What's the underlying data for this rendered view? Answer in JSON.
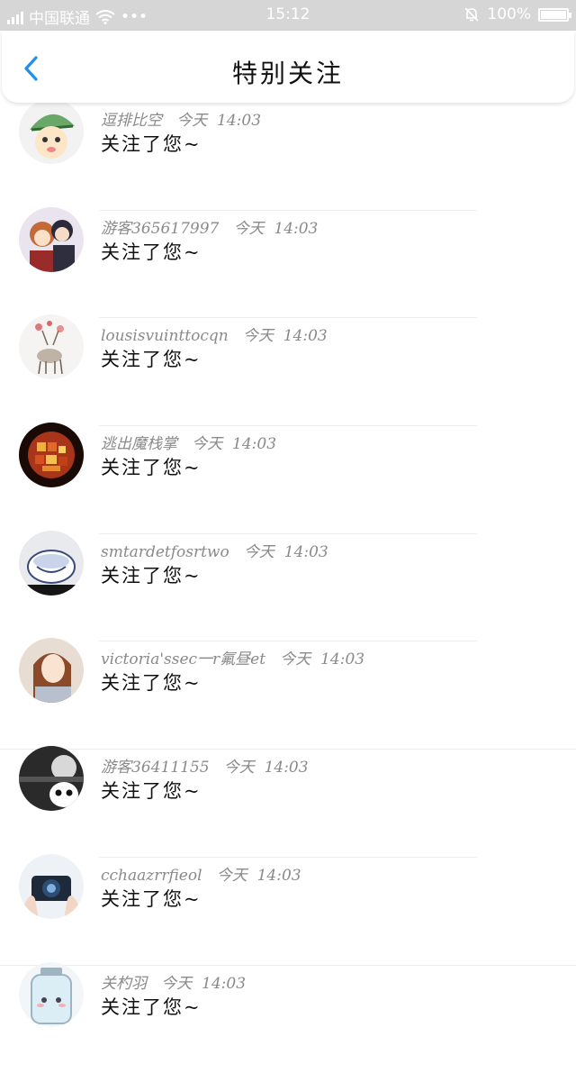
{
  "status": {
    "carrier": "中国联通",
    "time": "15:12",
    "battery": "100%",
    "battery_level": 1.0
  },
  "header": {
    "title": "特别关注",
    "back_icon": "chevron-left-icon"
  },
  "colors": {
    "accent": "#1e8ff0",
    "status_bar": "#d6d6d6"
  },
  "items": [
    {
      "name": "逗排比空",
      "date": "今天",
      "time": "14:03",
      "message": "关注了您~"
    },
    {
      "name": "游客365617997",
      "date": "今天",
      "time": "14:03",
      "message": "关注了您~"
    },
    {
      "name": "lousisvuinttocqn",
      "date": "今天",
      "time": "14:03",
      "message": "关注了您~"
    },
    {
      "name": "逃出魔栈掌",
      "date": "今天",
      "time": "14:03",
      "message": "关注了您~"
    },
    {
      "name": "smtardetfosrtwo",
      "date": "今天",
      "time": "14:03",
      "message": "关注了您~"
    },
    {
      "name": "victoria'ssec一r氟昼et",
      "date": "今天",
      "time": "14:03",
      "message": "关注了您~"
    },
    {
      "name": "游客36411155",
      "date": "今天",
      "time": "14:03",
      "message": "关注了您~"
    },
    {
      "name": "cchaazrrfieol",
      "date": "今天",
      "time": "14:03",
      "message": "关注了您~"
    },
    {
      "name": "关杓羽",
      "date": "今天",
      "time": "14:03",
      "message": "关注了您~"
    }
  ]
}
